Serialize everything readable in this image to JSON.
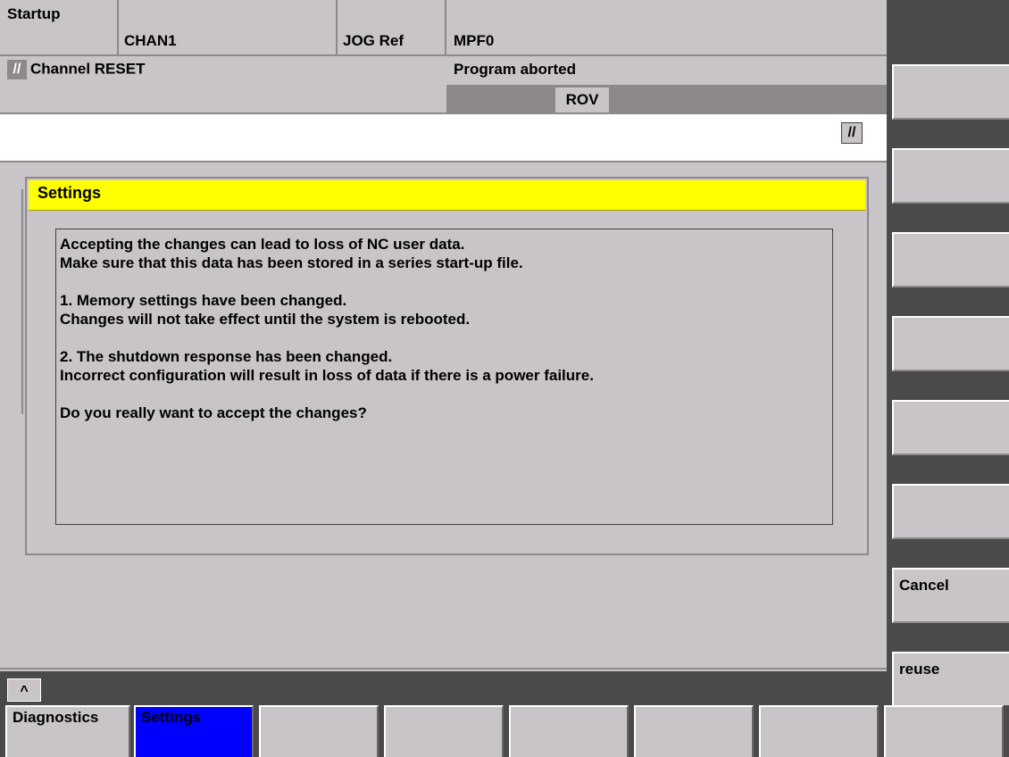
{
  "header": {
    "area": "Startup",
    "channel": "CHAN1",
    "mode": "JOG Ref",
    "program": "MPF0",
    "channel_status": "Channel RESET",
    "program_status": "Program aborted",
    "rov": "ROV",
    "reset_icon": "//"
  },
  "dialog": {
    "title": "Settings",
    "lines": [
      "Accepting the changes can lead to loss of NC user data.",
      "Make sure that this data has been stored in a series start-up file.",
      "",
      "1. Memory settings have been changed.",
      "Changes will not take effect until the system is rebooted.",
      "",
      "2. The shutdown response has been changed.",
      "Incorrect configuration will result in loss of data if there is a power failure.",
      "",
      "Do you really want to accept the changes?"
    ]
  },
  "vertical_softkeys": [
    "",
    "",
    "",
    "",
    "",
    "",
    "Cancel",
    "reuse"
  ],
  "horizontal_softkeys": [
    "Diagnostics",
    "Settings",
    "",
    "",
    "",
    "",
    "",
    ""
  ],
  "recall_icon": "^",
  "colors": {
    "title_yellow": "#ffff00",
    "active_softkey_blue": "#0000ff",
    "panel_gray": "#c8c4c8",
    "dark_gray": "#4a4a4a"
  }
}
